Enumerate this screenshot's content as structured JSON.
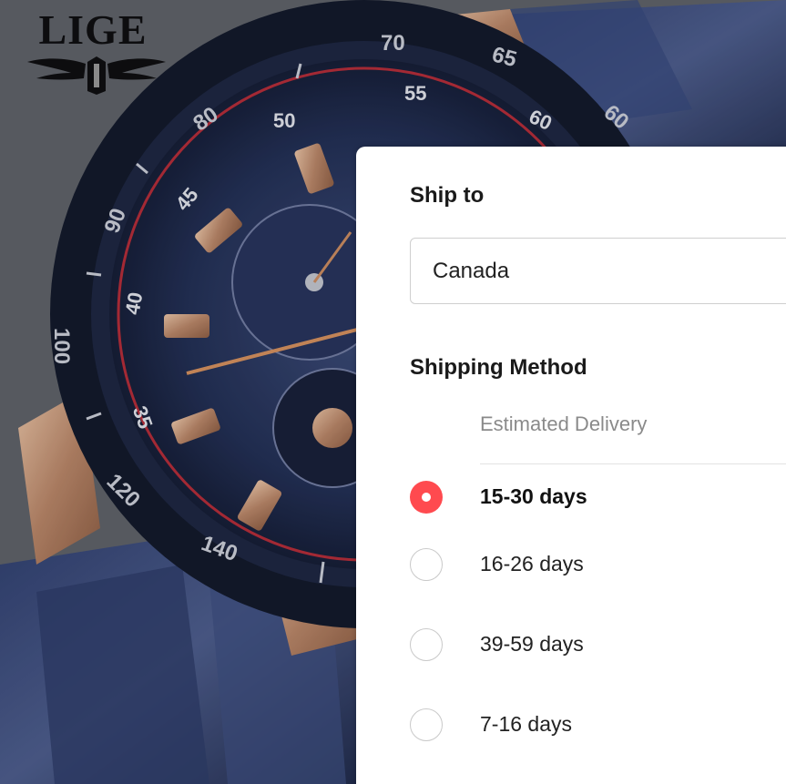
{
  "brand": {
    "logo_text": "LIGE"
  },
  "watch_dial": {
    "bezel_numbers": [
      "70",
      "65",
      "60",
      "80",
      "90",
      "100",
      "120",
      "140"
    ],
    "tachy_numbers": [
      "55",
      "50",
      "45",
      "40",
      "35",
      "60"
    ]
  },
  "shipping": {
    "ship_to_label": "Ship to",
    "country_value": "Canada",
    "method_label": "Shipping Method",
    "column_header": "Estimated Delivery",
    "options": [
      {
        "label": "15-30 days",
        "selected": true
      },
      {
        "label": "16-26 days",
        "selected": false
      },
      {
        "label": "39-59 days",
        "selected": false
      },
      {
        "label": "7-16 days",
        "selected": false
      }
    ]
  },
  "colors": {
    "accent": "#ff4a4f",
    "watch_blue": "#1e2a4f",
    "rose_gold": "#c79a7c"
  }
}
